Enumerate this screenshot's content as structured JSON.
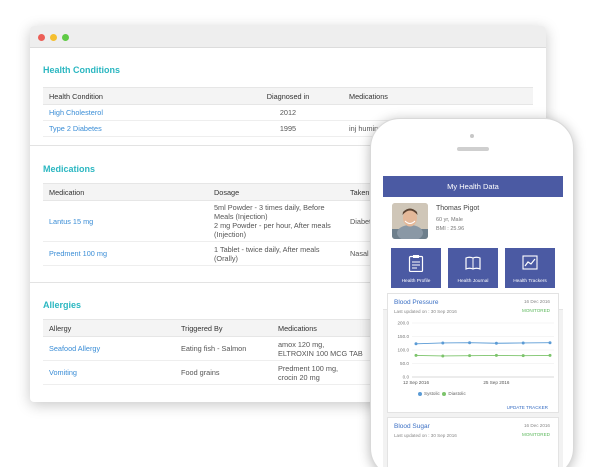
{
  "health_conditions": {
    "title": "Health Conditions",
    "headers": [
      "Health Condition",
      "Diagnosed in",
      "Medications"
    ],
    "rows": [
      {
        "condition": "High Cholesterol",
        "diagnosed": "2012",
        "medications": ""
      },
      {
        "condition": "Type 2 Diabetes",
        "diagnosed": "1995",
        "medications": "inj huminsulin"
      }
    ]
  },
  "medications": {
    "title": "Medications",
    "headers": [
      "Medication",
      "Dosage",
      "Taken"
    ],
    "rows": [
      {
        "name": "Lantus 15 mg",
        "dosage_lines": [
          "5ml Powder - 3 times daily, Before",
          "Meals (Injection)",
          "2 mg Powder - per hour, After meals",
          "(Injection)"
        ],
        "taken": "Diabet"
      },
      {
        "name": "Predment 100 mg",
        "dosage_lines": [
          "1 Tablet - twice daily, After meals",
          "(Orally)"
        ],
        "taken": "Nasal I"
      }
    ]
  },
  "allergies": {
    "title": "Allergies",
    "headers": [
      "Allergy",
      "Triggered By",
      "Medications"
    ],
    "rows": [
      {
        "allergy": "Seafood Allergy",
        "trigger": "Eating fish - Salmon",
        "med_lines": [
          "amox 120 mg,",
          "ELTROXIN 100 MCG TAB"
        ]
      },
      {
        "allergy": "Vomiting",
        "trigger": "Food grains",
        "med_lines": [
          "Predment 100 mg,",
          "crocin 20 mg"
        ]
      }
    ]
  },
  "phone": {
    "app_title": "My Health Data",
    "profile": {
      "name": "Thomas Pigot",
      "age_sex": "60 yr, Male",
      "bmi": "BMI : 25.96"
    },
    "tiles": [
      {
        "label": "Health Profile",
        "icon": "clipboard-icon"
      },
      {
        "label": "Health Journal",
        "icon": "book-icon"
      },
      {
        "label": "Health Trackers",
        "icon": "trend-chart-icon"
      }
    ],
    "blood_pressure": {
      "title": "Blood Pressure",
      "updated": "Last updated on : 30 Sep 2016",
      "date": "16 Dec 2016",
      "status": "MONITORED",
      "update_link": "UPDATE TRACKER"
    },
    "blood_sugar": {
      "title": "Blood Sugar",
      "updated": "Last updated on : 30 Sep 2016",
      "date": "16 Dec 2016",
      "status": "MONITORED"
    }
  },
  "chart_data": {
    "type": "line",
    "title": "Blood Pressure",
    "x": [
      "12 Sep 2016",
      "",
      "",
      "25 Sep 2016",
      "",
      ""
    ],
    "x_ticks": [
      "12 Sep 2016",
      "25 Sep 2016"
    ],
    "series": [
      {
        "name": "Systolic",
        "values": [
          123,
          126,
          127,
          125,
          126,
          127
        ],
        "color": "#5b9bd5"
      },
      {
        "name": "Diastolic",
        "values": [
          80,
          78,
          79,
          80,
          79,
          80
        ],
        "color": "#7cc46b"
      }
    ],
    "yticks": [
      "200.0",
      "150.0",
      "100.0",
      "50.0",
      "0.0"
    ],
    "ylim": [
      0,
      200
    ],
    "legend": "bottom"
  },
  "colors": {
    "accent": "#2bb7c1",
    "link": "#3a8dd6",
    "brand": "#4b5aa3",
    "monitored": "#5cb85c"
  }
}
